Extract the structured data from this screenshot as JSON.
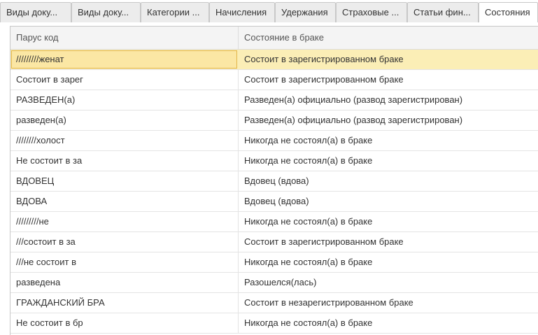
{
  "tabs": [
    {
      "label": "Виды доку..."
    },
    {
      "label": "Виды доку..."
    },
    {
      "label": "Категории ..."
    },
    {
      "label": "Начисления"
    },
    {
      "label": "Удержания"
    },
    {
      "label": "Страховые ..."
    },
    {
      "label": "Статьи фин..."
    },
    {
      "label": "Состояния"
    }
  ],
  "grid": {
    "columns": [
      "Парус код",
      "Состояние в браке"
    ],
    "rows": [
      {
        "code": "/////////женат",
        "state": "Состоит в зарегистрированном браке"
      },
      {
        "code": "Состоит в зарег",
        "state": "Состоит в зарегистрированном браке"
      },
      {
        "code": "РАЗВЕДЕН(а)",
        "state": "Разведен(а) официально (развод зарегистрирован)"
      },
      {
        "code": "разведен(а)",
        "state": "Разведен(а) официально (развод зарегистрирован)"
      },
      {
        "code": "////////холост",
        "state": "Никогда не состоял(а) в браке"
      },
      {
        "code": "Не состоит в за",
        "state": "Никогда не состоял(а) в браке"
      },
      {
        "code": "ВДОВЕЦ",
        "state": "Вдовец (вдова)"
      },
      {
        "code": "ВДОВА",
        "state": "Вдовец (вдова)"
      },
      {
        "code": "/////////не",
        "state": "Никогда не состоял(а) в браке"
      },
      {
        "code": "///состоит в за",
        "state": "Состоит в зарегистрированном браке"
      },
      {
        "code": "///не состоит в",
        "state": "Никогда не состоял(а) в браке"
      },
      {
        "code": "разведена",
        "state": "Разошелся(лась)"
      },
      {
        "code": "ГРАЖДАНСКИЙ БРА",
        "state": "Состоит в незарегистрированном браке"
      },
      {
        "code": "Не состоит в бр",
        "state": "Никогда не состоял(а) в браке"
      }
    ]
  },
  "colors": {
    "selected_row": "#fbeeb6",
    "selected_border": "#e3b64a",
    "tab_bg": "#ececec"
  }
}
